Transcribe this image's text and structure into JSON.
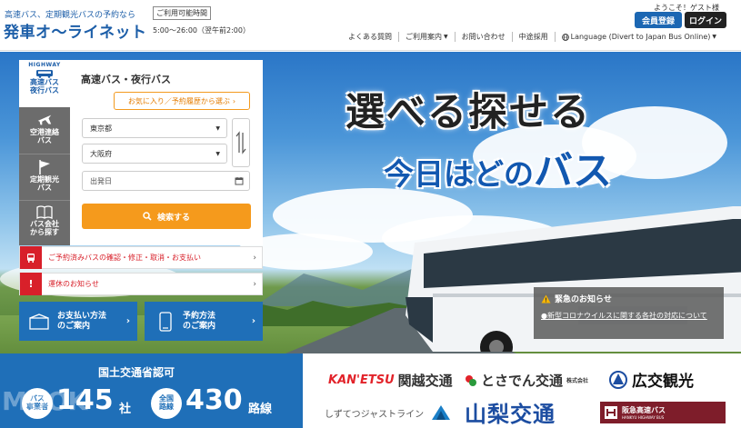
{
  "header": {
    "tagline": "高速バス、定期観光バスの予約なら",
    "logo": "発車オ〜ライネット",
    "hours_label": "ご利用可能時間",
    "hours_value": "5:00〜26:00（翌午前2:00）",
    "welcome": "ようこそ！ゲスト様",
    "register_label": "会員登録",
    "login_label": "ログイン",
    "nav": [
      {
        "label": "よくある質問",
        "icon": ""
      },
      {
        "label": "ご利用案内",
        "icon": "chevron-down-icon"
      },
      {
        "label": "お問い合わせ",
        "icon": ""
      },
      {
        "label": "中途採用",
        "icon": ""
      },
      {
        "label": "Language (Divert to Japan Bus Online)",
        "icon": "globe-icon"
      }
    ]
  },
  "hero": {
    "headline1": "選べる探せる",
    "headline2_small": "今日はどの",
    "headline2_big": "バス"
  },
  "side_tabs": {
    "highway_en": "HIGHWAY",
    "highway": "高速バス\n夜行バス",
    "airport": "空港連絡\nバス",
    "tour": "定期観光\nバス",
    "company": "バス会社\nから探す"
  },
  "search": {
    "title": "高速バス・夜行バス",
    "favorites_label": "お気に入り／予約履歴から選ぶ",
    "from_value": "東京都",
    "to_value": "大阪府",
    "date_placeholder": "出発日",
    "search_label": "検索する"
  },
  "notices": {
    "reservation": "ご予約済みバスの確認・修正・取消・お支払い",
    "suspension": "運休のお知らせ"
  },
  "info_buttons": {
    "payment": "お支払い方法\nのご案内",
    "reservation": "予約方法\nのご案内"
  },
  "emergency": {
    "title": "緊急のお知らせ",
    "body": "●新型コロナウイルスに関する各社の対応について"
  },
  "stats": {
    "mlit": "国土交通省認可",
    "companies_badge": "バス\n事業者",
    "companies_num": "145",
    "companies_unit": "社",
    "routes_badge": "全国\n路線",
    "routes_num": "430",
    "routes_unit": "路線"
  },
  "watermark": "MOOK",
  "partners": {
    "kanetsu": "関越交通",
    "kanetsu_mark": "KAN'ETSU",
    "tosaden": "とさでん交通",
    "tosaden_sub": "株式会社",
    "koukou": "広交観光",
    "shizutetsu": "しずてつジャストライン",
    "yamanashi": "山梨交通",
    "hankyu": "阪急高速バス",
    "hankyu_en": "HANKYU HIGHWAY BUS"
  },
  "colors": {
    "brand_blue": "#1c5ea8",
    "orange": "#f59a1c",
    "alert_red": "#d8202a",
    "dark": "#222222"
  }
}
